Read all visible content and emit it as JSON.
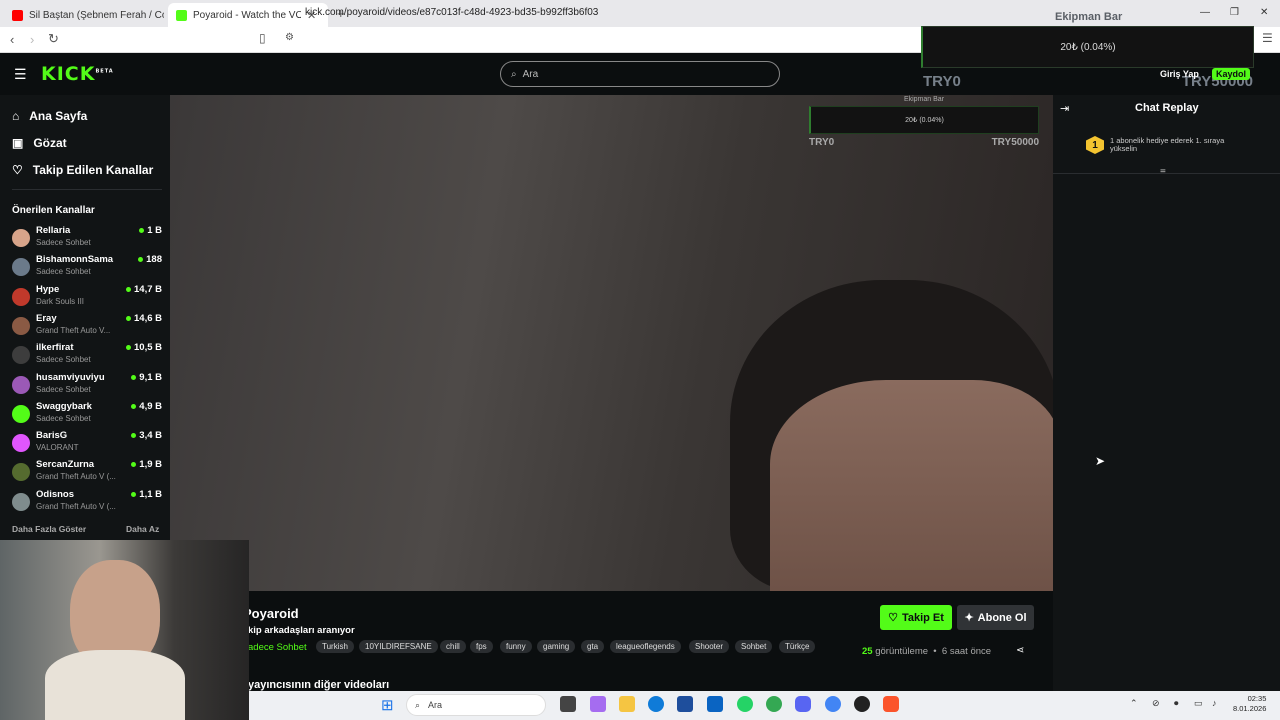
{
  "browser": {
    "tabs": [
      {
        "label": "Sil Baştan (Şebnem Ferah / Cover) - YouTube",
        "favicon_color": "#ff0000"
      },
      {
        "label": "Poyaroid - Watch the VOD on Kick",
        "favicon_color": "#53fc18"
      }
    ],
    "new_tab": "+",
    "url": "kick.com/poyaroid/videos/e87c013f-c48d-4923-bd35-b992ff3b6f03"
  },
  "header": {
    "logo": "KICK",
    "logo_badge": "BETA",
    "search_placeholder": "Ara",
    "login": "Giriş Yap",
    "signup": "Kaydol"
  },
  "sidebar": {
    "nav": [
      {
        "label": "Ana Sayfa",
        "icon": "home-icon"
      },
      {
        "label": "Gözat",
        "icon": "browse-icon"
      },
      {
        "label": "Takip Edilen Kanallar",
        "icon": "heart-icon"
      }
    ],
    "section_title": "Önerilen Kanallar",
    "channels": [
      {
        "name": "Rellaria",
        "category": "Sadece Sohbet",
        "viewers": "1 B",
        "color": "#d7a48a"
      },
      {
        "name": "BishamonnSama",
        "category": "Sadece Sohbet",
        "viewers": "188",
        "color": "#6b7a8a"
      },
      {
        "name": "Hype",
        "category": "Dark Souls III",
        "viewers": "14,7 B",
        "color": "#c0392b"
      },
      {
        "name": "Eray",
        "category": "Grand Theft Auto V...",
        "viewers": "14,6 B",
        "color": "#8a5a44"
      },
      {
        "name": "ilkerfirat",
        "category": "Sadece Sohbet",
        "viewers": "10,5 B",
        "color": "#3d3d3d"
      },
      {
        "name": "husamviyuviyu",
        "category": "Sadece Sohbet",
        "viewers": "9,1 B",
        "color": "#9b59b6"
      },
      {
        "name": "Swaggybark",
        "category": "Sadece Sohbet",
        "viewers": "4,9 B",
        "color": "#53fc18"
      },
      {
        "name": "BarisG",
        "category": "VALORANT",
        "viewers": "3,4 B",
        "color": "#e056fd"
      },
      {
        "name": "SercanZurna",
        "category": "Grand Theft Auto V (...",
        "viewers": "1,9 B",
        "color": "#556b2f"
      },
      {
        "name": "Odisnos",
        "category": "Grand Theft Auto V (...",
        "viewers": "1,1 B",
        "color": "#7f8c8d"
      }
    ],
    "show_more": "Daha Fazla Göster",
    "show_less": "Daha Az"
  },
  "video_overlay": {
    "title": "Ekipman Bar",
    "progress_text": "20₺ (0.04%)",
    "progress_fraction": 0.0004,
    "min_label": "TRY0",
    "max_label": "TRY50000"
  },
  "top_overlay": {
    "title": "Ekipman Bar",
    "progress_text": "20₺ (0.04%)",
    "min_label": "TRY0",
    "max_label": "TRY50000"
  },
  "chat": {
    "title": "Chat Replay",
    "rank": "1",
    "message": "1 abonelik hediye ederek 1. sıraya yükselin"
  },
  "stream": {
    "streamer": "Poyaroid",
    "title": "kip arkadaşları aranıyor",
    "category": "adece Sohbet",
    "tags": [
      "Turkish",
      "10YILDIREFSANE",
      "chill",
      "fps",
      "funny",
      "gaming",
      "gta",
      "leagueoflegends",
      "Shooter",
      "Sohbet",
      "Türkçe"
    ],
    "follow_label": "Takip Et",
    "subscribe_label": "Abone Ol",
    "views_count": "25",
    "views_label": "görüntüleme",
    "time_ago": "6 saat önce",
    "other_videos": "yayıncısının diğer videoları"
  },
  "taskbar": {
    "search_placeholder": "Ara",
    "time": "02:35",
    "date": "8.01.2026"
  }
}
